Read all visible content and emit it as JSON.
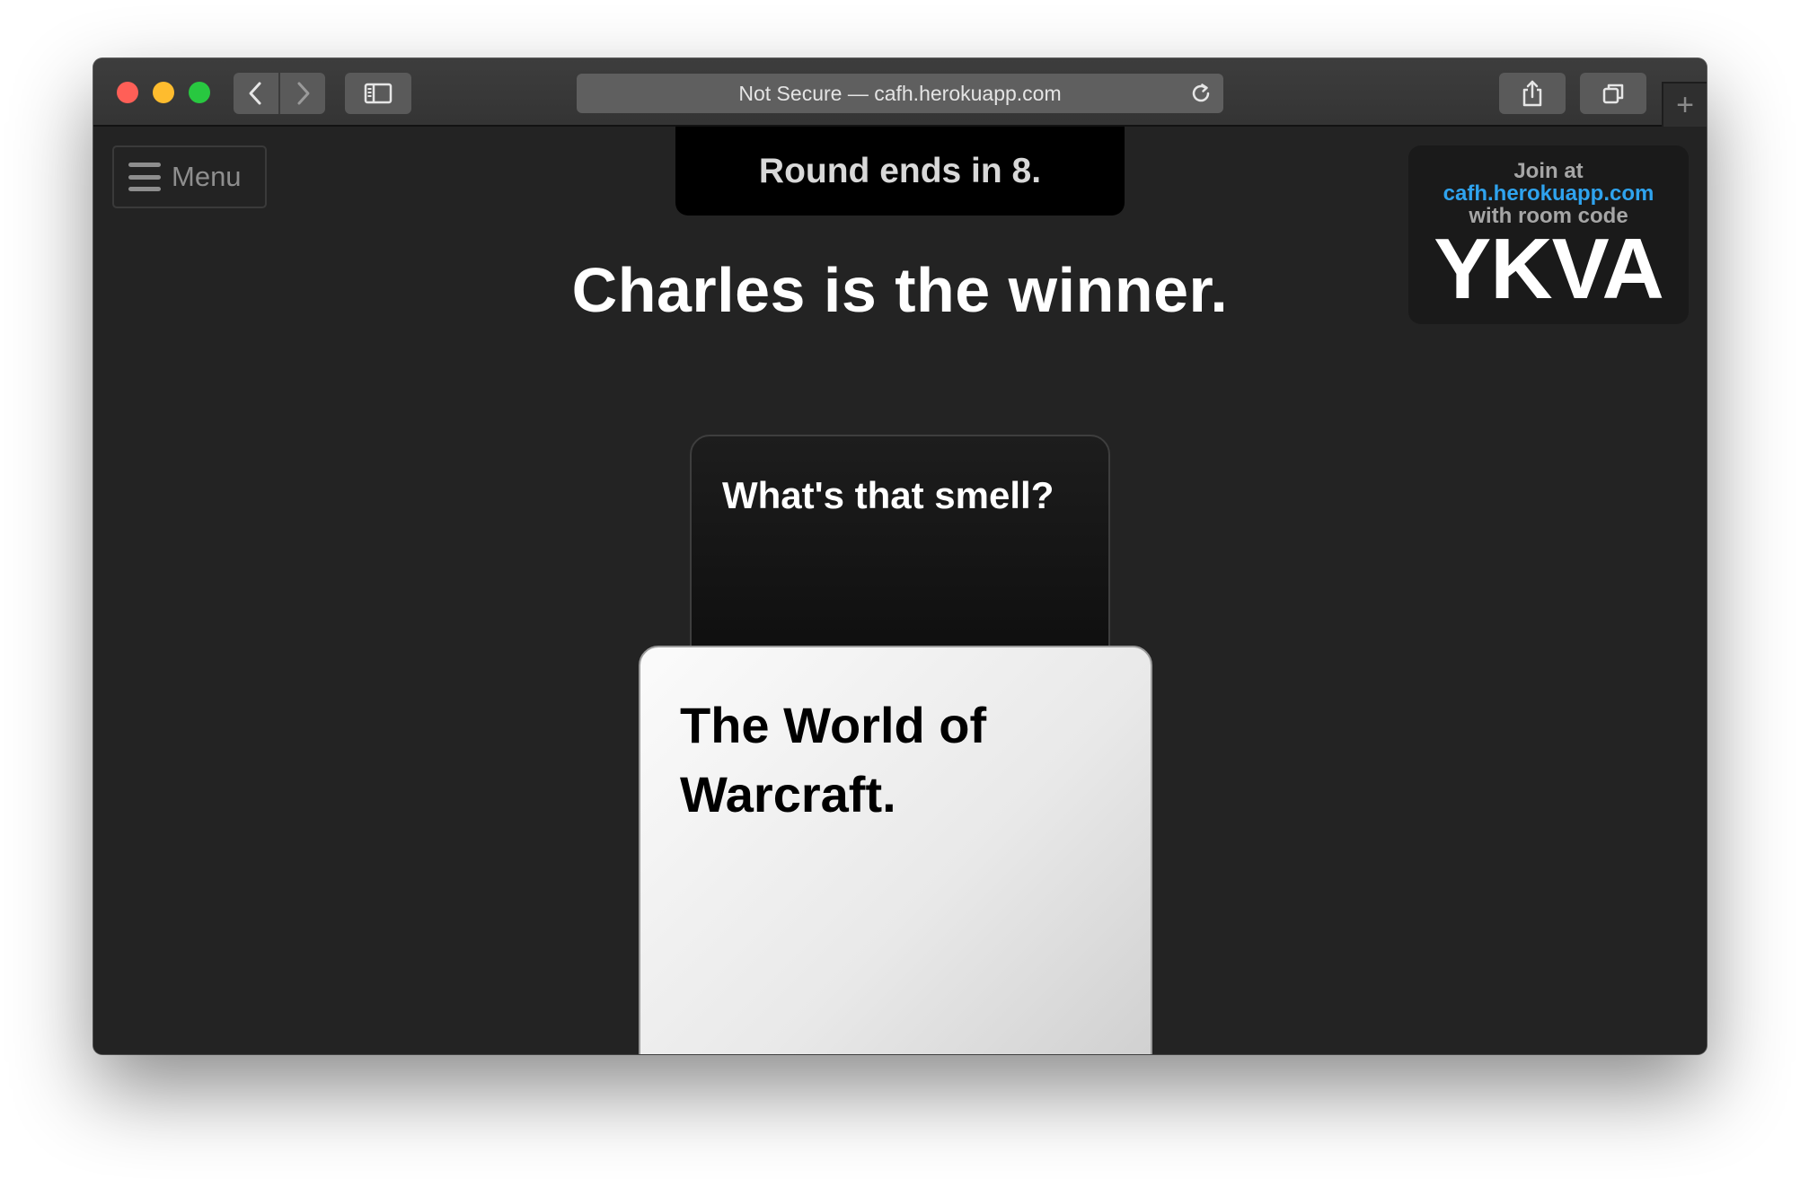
{
  "browser": {
    "address_text": "Not Secure — cafh.herokuapp.com",
    "new_tab_label": "+",
    "traffic_colors": [
      "#ff5f57",
      "#febc2e",
      "#28c840"
    ]
  },
  "menu": {
    "label": "Menu"
  },
  "round": {
    "timer_text": "Round ends in 8."
  },
  "result": {
    "winner_text": "Charles is the winner."
  },
  "join": {
    "line1": "Join at",
    "url": "cafh.herokuapp.com",
    "line2": "with room code",
    "room_code": "YKVA",
    "url_color": "#2fa3ee"
  },
  "cards": {
    "black_card_text": "What's that smell?",
    "white_card_text": "The World of Warcraft."
  }
}
